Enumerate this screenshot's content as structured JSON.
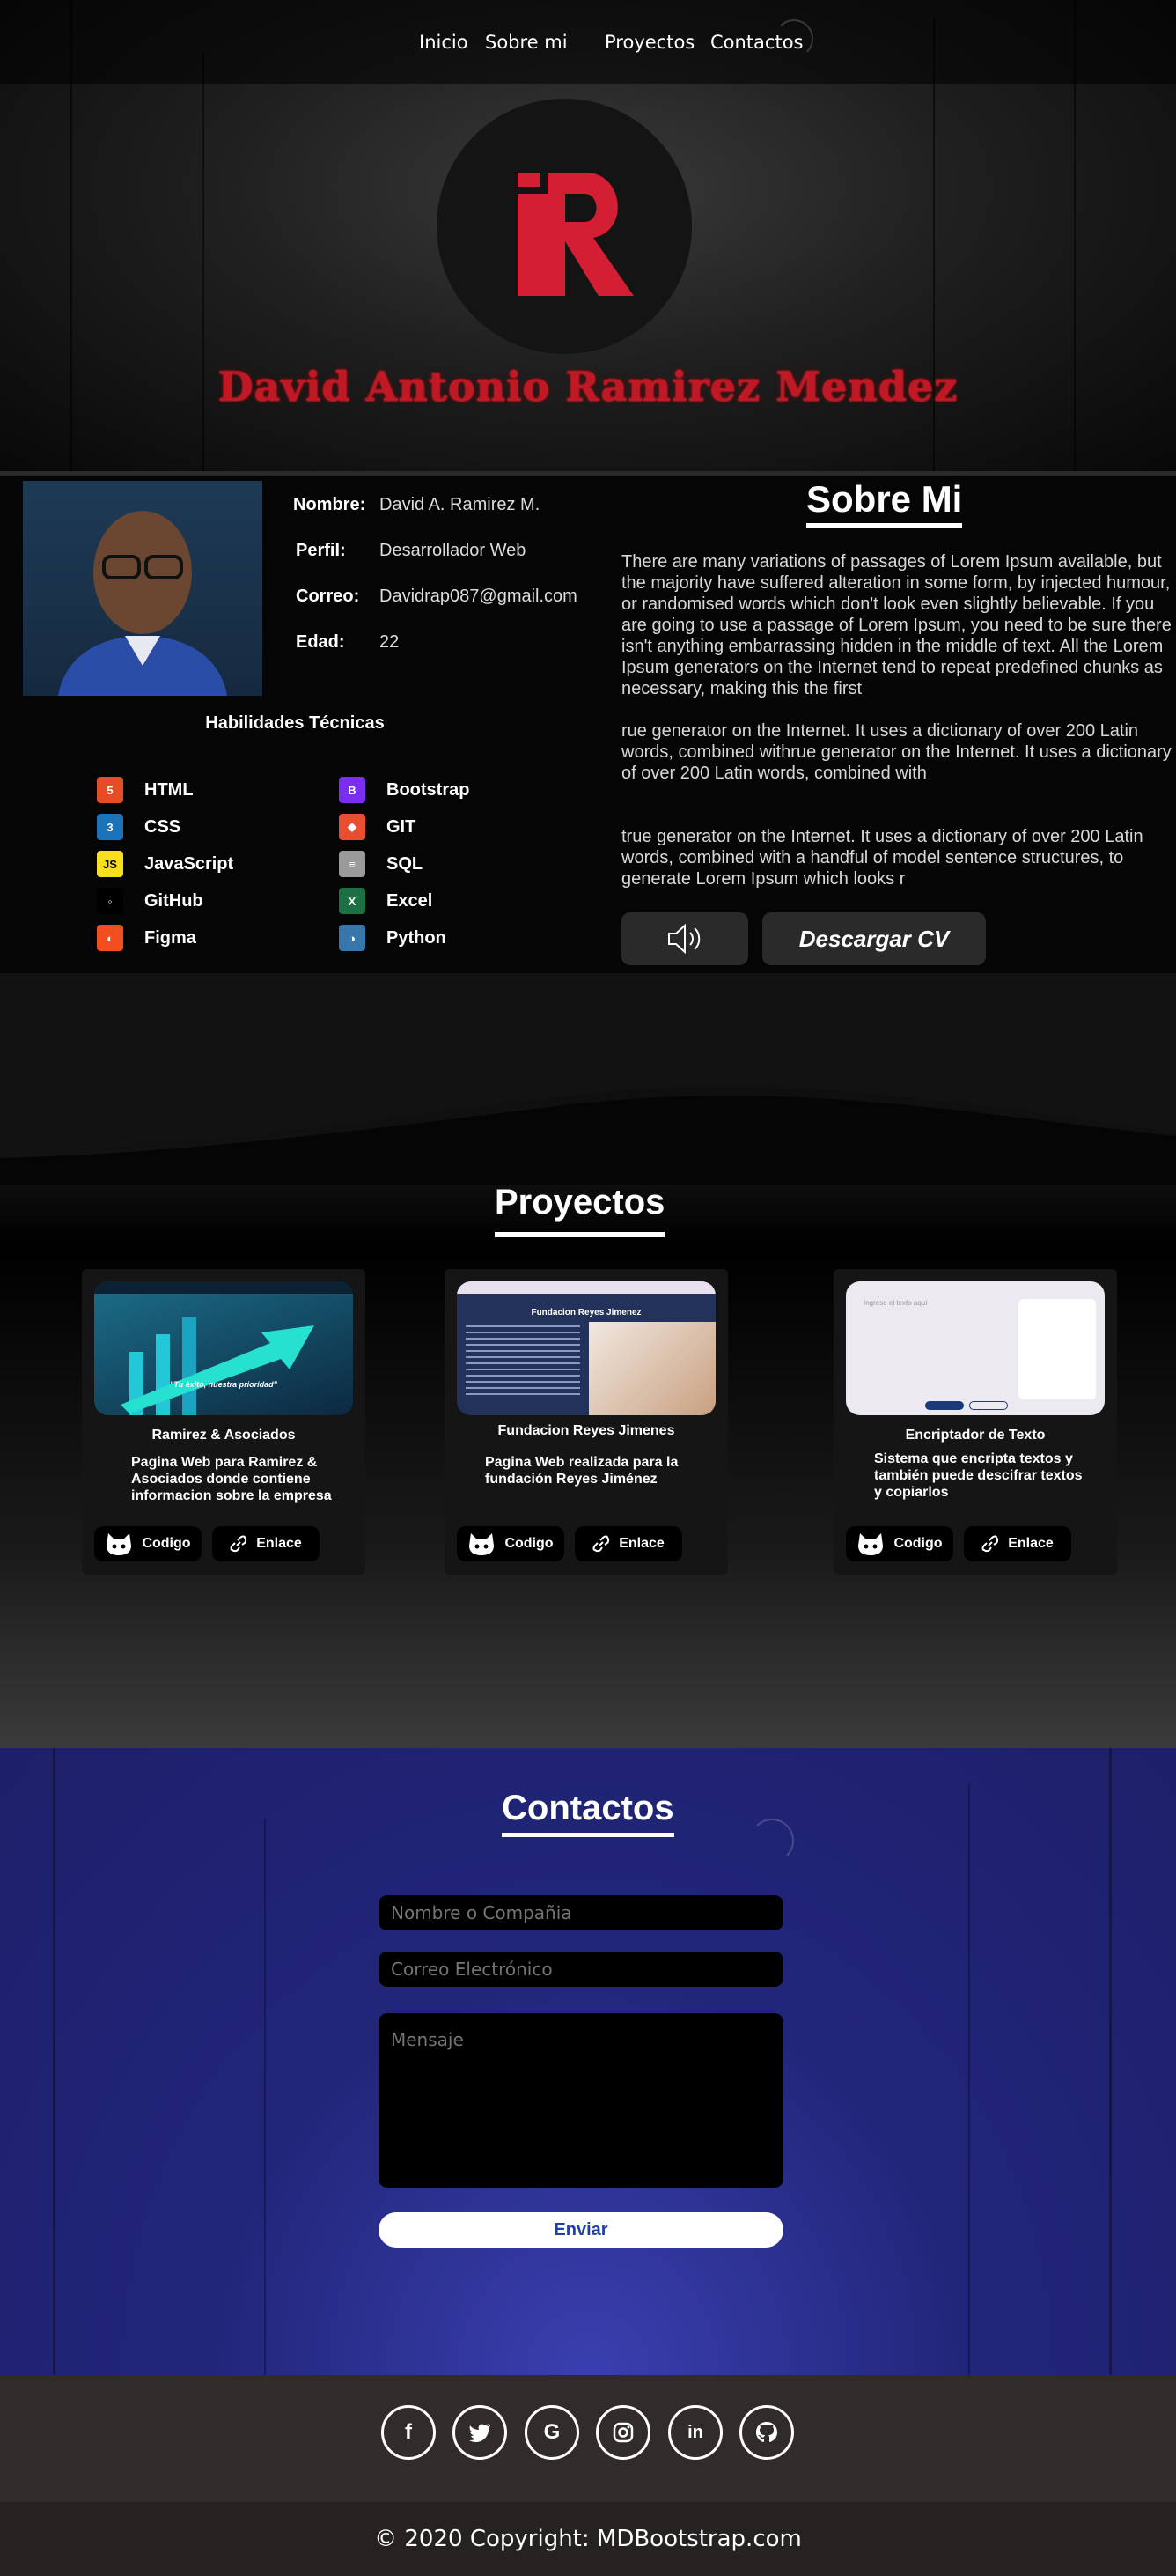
{
  "nav": {
    "items": [
      "Inicio",
      "Sobre mi",
      "Proyectos",
      "Contactos"
    ]
  },
  "hero": {
    "name": "David Antonio Ramirez Mendez",
    "brand_color": "#d41e33"
  },
  "profile": {
    "fields": [
      {
        "label": "Nombre:",
        "value": "David A. Ramirez M."
      },
      {
        "label": "Perfil:",
        "value": "Desarrollador Web"
      },
      {
        "label": "Correo:",
        "value": "Davidrap087@gmail.com"
      },
      {
        "label": "Edad:",
        "value": "22"
      }
    ],
    "skills_title": "Habilidades Técnicas",
    "skills": [
      {
        "name": "HTML",
        "icon": "html5-icon",
        "glyph": "5",
        "color": "#e44d26"
      },
      {
        "name": "Bootstrap",
        "icon": "bootstrap-icon",
        "glyph": "B",
        "color": "#7a2ff0"
      },
      {
        "name": "CSS",
        "icon": "css3-icon",
        "glyph": "3",
        "color": "#1b73ba"
      },
      {
        "name": "GIT",
        "icon": "git-icon",
        "glyph": "◆",
        "color": "#e84e31"
      },
      {
        "name": "JavaScript",
        "icon": "javascript-icon",
        "glyph": "JS",
        "color": "#f7df1e"
      },
      {
        "name": "SQL",
        "icon": "database-icon",
        "glyph": "≡",
        "color": "#9a9a9a"
      },
      {
        "name": "GitHub",
        "icon": "github-icon",
        "glyph": "◦",
        "color": "#000000"
      },
      {
        "name": "Excel",
        "icon": "excel-icon",
        "glyph": "X",
        "color": "#1d7044"
      },
      {
        "name": "Figma",
        "icon": "figma-icon",
        "glyph": "◐",
        "color": "#f24e1e"
      },
      {
        "name": "Python",
        "icon": "python-icon",
        "glyph": "◑",
        "color": "#3776ab"
      }
    ]
  },
  "about": {
    "title": "Sobre Mi",
    "paragraphs": [
      "There are many variations of passages of Lorem Ipsum available, but the majority have suffered alteration in some form, by injected humour, or randomised words which don't look even slightly believable. If you are going to use a passage of Lorem Ipsum, you need to be sure there isn't anything embarrassing hidden in the middle of text. All the Lorem Ipsum generators on the Internet tend to repeat predefined chunks as necessary, making this the first",
      "rue generator on the Internet. It uses a dictionary of over 200 Latin words, combined withrue generator on the Internet. It uses a dictionary of over 200 Latin words, combined with",
      "true generator on the Internet. It uses a dictionary of over 200 Latin words, combined with a handful of model sentence structures, to generate Lorem Ipsum which looks r"
    ],
    "cv_button": "Descargar CV"
  },
  "projects": {
    "title": "Proyectos",
    "items": [
      {
        "title": "Ramirez & Asociados",
        "desc": "Pagina Web para Ramirez & Asociados donde contiene informacion sobre la empresa",
        "code": "Codigo",
        "link": "Enlace",
        "thumb_caption": "\"Tu éxito, nuestra prioridad\""
      },
      {
        "title": "Fundacion Reyes Jimenes",
        "desc": "Pagina Web realizada para la fundación Reyes Jiménez",
        "code": "Codigo",
        "link": "Enlace",
        "thumb_caption": "Fundacion Reyes Jimenez"
      },
      {
        "title": "Encriptador de Texto",
        "desc": "Sistema que encripta textos y también puede descifrar textos y copiarlos",
        "code": "Codigo",
        "link": "Enlace",
        "thumb_caption": "Ingrese el texto aquí"
      }
    ]
  },
  "contact": {
    "title": "Contactos",
    "name_placeholder": "Nombre o Compañia",
    "email_placeholder": "Correo Electrónico",
    "message_placeholder": "Mensaje",
    "send": "Enviar"
  },
  "footer": {
    "socials": [
      "facebook-icon",
      "twitter-icon",
      "google-icon",
      "instagram-icon",
      "linkedin-icon",
      "github-icon"
    ],
    "copyright": "© 2020 Copyright: MDBootstrap.com"
  }
}
